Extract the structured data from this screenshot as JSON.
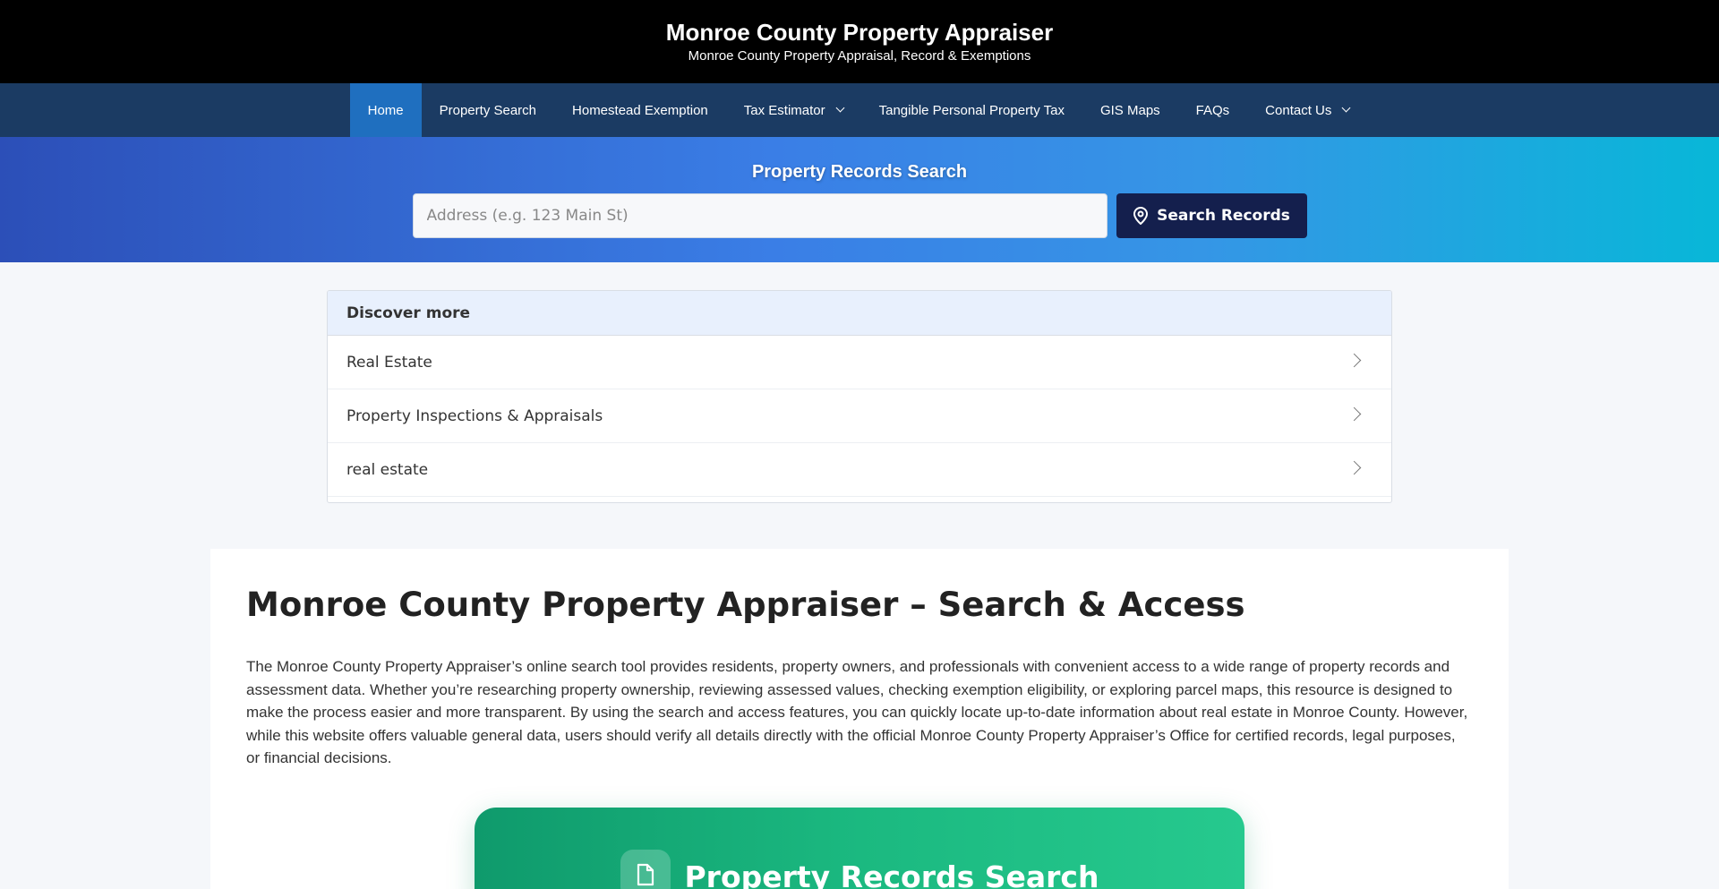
{
  "header": {
    "title": "Monroe County Property Appraiser",
    "tagline": "Monroe County Property Appraisal, Record & Exemptions"
  },
  "nav": {
    "items": [
      {
        "label": "Home",
        "active": true
      },
      {
        "label": "Property Search"
      },
      {
        "label": "Homestead Exemption"
      },
      {
        "label": "Tax Estimator",
        "has_dropdown": true
      },
      {
        "label": "Tangible Personal Property Tax"
      },
      {
        "label": "GIS Maps"
      },
      {
        "label": "FAQs"
      },
      {
        "label": "Contact Us",
        "has_dropdown": true
      }
    ]
  },
  "hero": {
    "title": "Property Records Search",
    "search_placeholder": "Address (e.g. 123 Main St)",
    "search_button": "Search Records",
    "search_icon": "map-pin-icon"
  },
  "discover": {
    "heading": "Discover more",
    "items": [
      {
        "label": "Real Estate"
      },
      {
        "label": "Property Inspections & Appraisals"
      },
      {
        "label": "real estate"
      }
    ]
  },
  "main": {
    "title": "Monroe County Property Appraiser – Search & Access",
    "intro": "The Monroe County Property Appraiser’s online search tool provides residents, property owners, and professionals with convenient access to a wide range of property records and assessment data. Whether you’re researching property ownership, reviewing assessed values, checking exemption eligibility, or exploring parcel maps, this resource is designed to make the process easier and more transparent. By using the search and access features, you can quickly locate up-to-date information about real estate in Monroe County. However, while this website offers valuable general data, users should verify all details directly with the official Monroe County Property Appraiser’s Office for certified records, legal purposes, or financial decisions."
  },
  "records_card": {
    "title": "Property Records Search",
    "icon": "document-icon"
  },
  "colors": {
    "topbar": "#000000",
    "navbar": "#1b3b63",
    "nav_active": "#1f6fbf",
    "search_button": "#141f4d",
    "card_green": "#1bb980"
  }
}
